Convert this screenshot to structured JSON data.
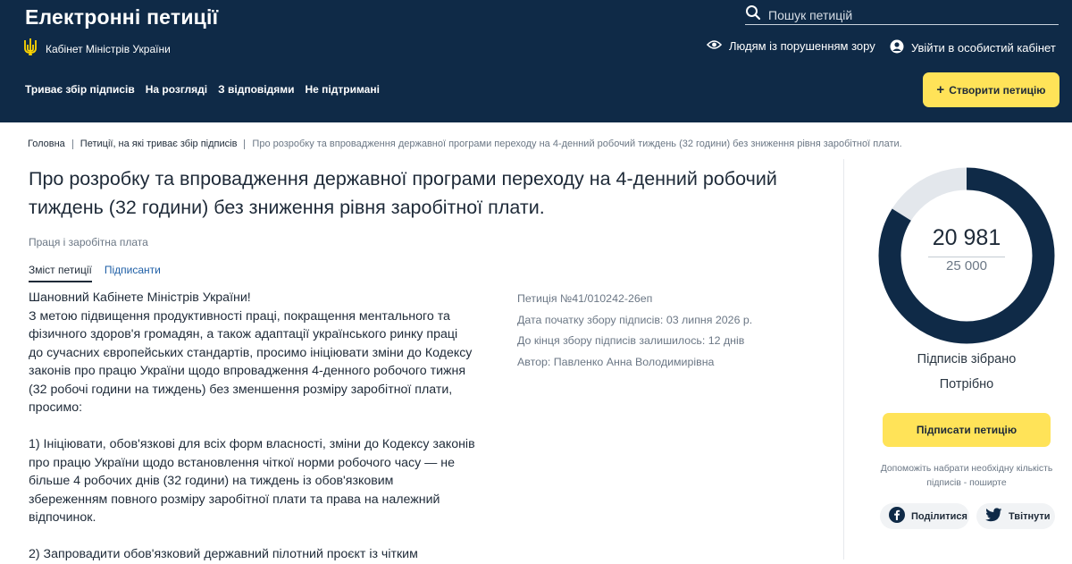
{
  "header": {
    "site_title": "Електронні петиції",
    "org_name": "Кабінет Міністрів України",
    "search_placeholder": "Пошук петицій",
    "vision_link": "Людям із порушенням зору",
    "login_link": "Увійти в особистий кабінет",
    "create_button": "Створити петицію",
    "nav": [
      "Триває збір підписів",
      "На розгляді",
      "З відповідями",
      "Не підтримані"
    ]
  },
  "breadcrumbs": {
    "home": "Головна",
    "section": "Петиції, на які триває збір підписів",
    "current": "Про розробку та впровадження державної програми переходу на 4-денний робочий тиждень (32 години) без зниження рівня заробітної плати."
  },
  "petition": {
    "title": "Про розробку та впровадження державної програми переходу на 4-денний робочий тиждень (32 години) без зниження рівня заробітної плати.",
    "category": "Праця і заробітна плата",
    "tabs": [
      "Зміст петиції",
      "Підписанти"
    ],
    "body": {
      "greeting": "Шановний Кабінете Міністрів України!",
      "intro": "З метою підвищення продуктивності праці, покращення ментального та фізичного здоров'я громадян, а також адаптації українського ринку праці до сучасних європейських стандартів, просимо ініціювати зміни до Кодексу законів про працю України щодо впровадження 4-денного робочого тижня (32 робочі години на тиждень) без зменшення розміру заробітної плати, просимо:",
      "point1": "1) Ініціювати, обов'язкові для всіх форм власності, зміни до Кодексу законів про працю України щодо встановлення чіткої норми робочого часу — не більше 4 робочих днів (32 години) на тиждень із обов'язковим збереженням повного розміру заробітної плати та права на належний відпочинок.",
      "point2": "2) Запровадити обов'язковий державний пілотний проєкт із чітким"
    },
    "meta": {
      "number": "Петиція №41/010242-26еп",
      "start_date": "Дата початку збору підписів: 03 липня 2026 р.",
      "remaining": "До кінця збору підписів залишилось: 12 днів",
      "author": "Автор: Павленко Анна Володимирівна"
    }
  },
  "signatures": {
    "count": "20 981",
    "target": "25 000",
    "progress": 0.8392,
    "collected_label": "Підписів зібрано",
    "needed_label": "Потрібно",
    "sign_button": "Підписати петицію",
    "help_text": "Допоможіть набрати необхідну кількість підписів - поширте",
    "facebook_share": "Поділитися",
    "twitter_share": "Твітнути"
  },
  "colors": {
    "header_bg": "#0f2a47",
    "accent_yellow": "#ffe358",
    "gauge_fill": "#0f2a47",
    "gauge_track": "#e3e7ec",
    "link_blue": "#1f5fa6"
  }
}
